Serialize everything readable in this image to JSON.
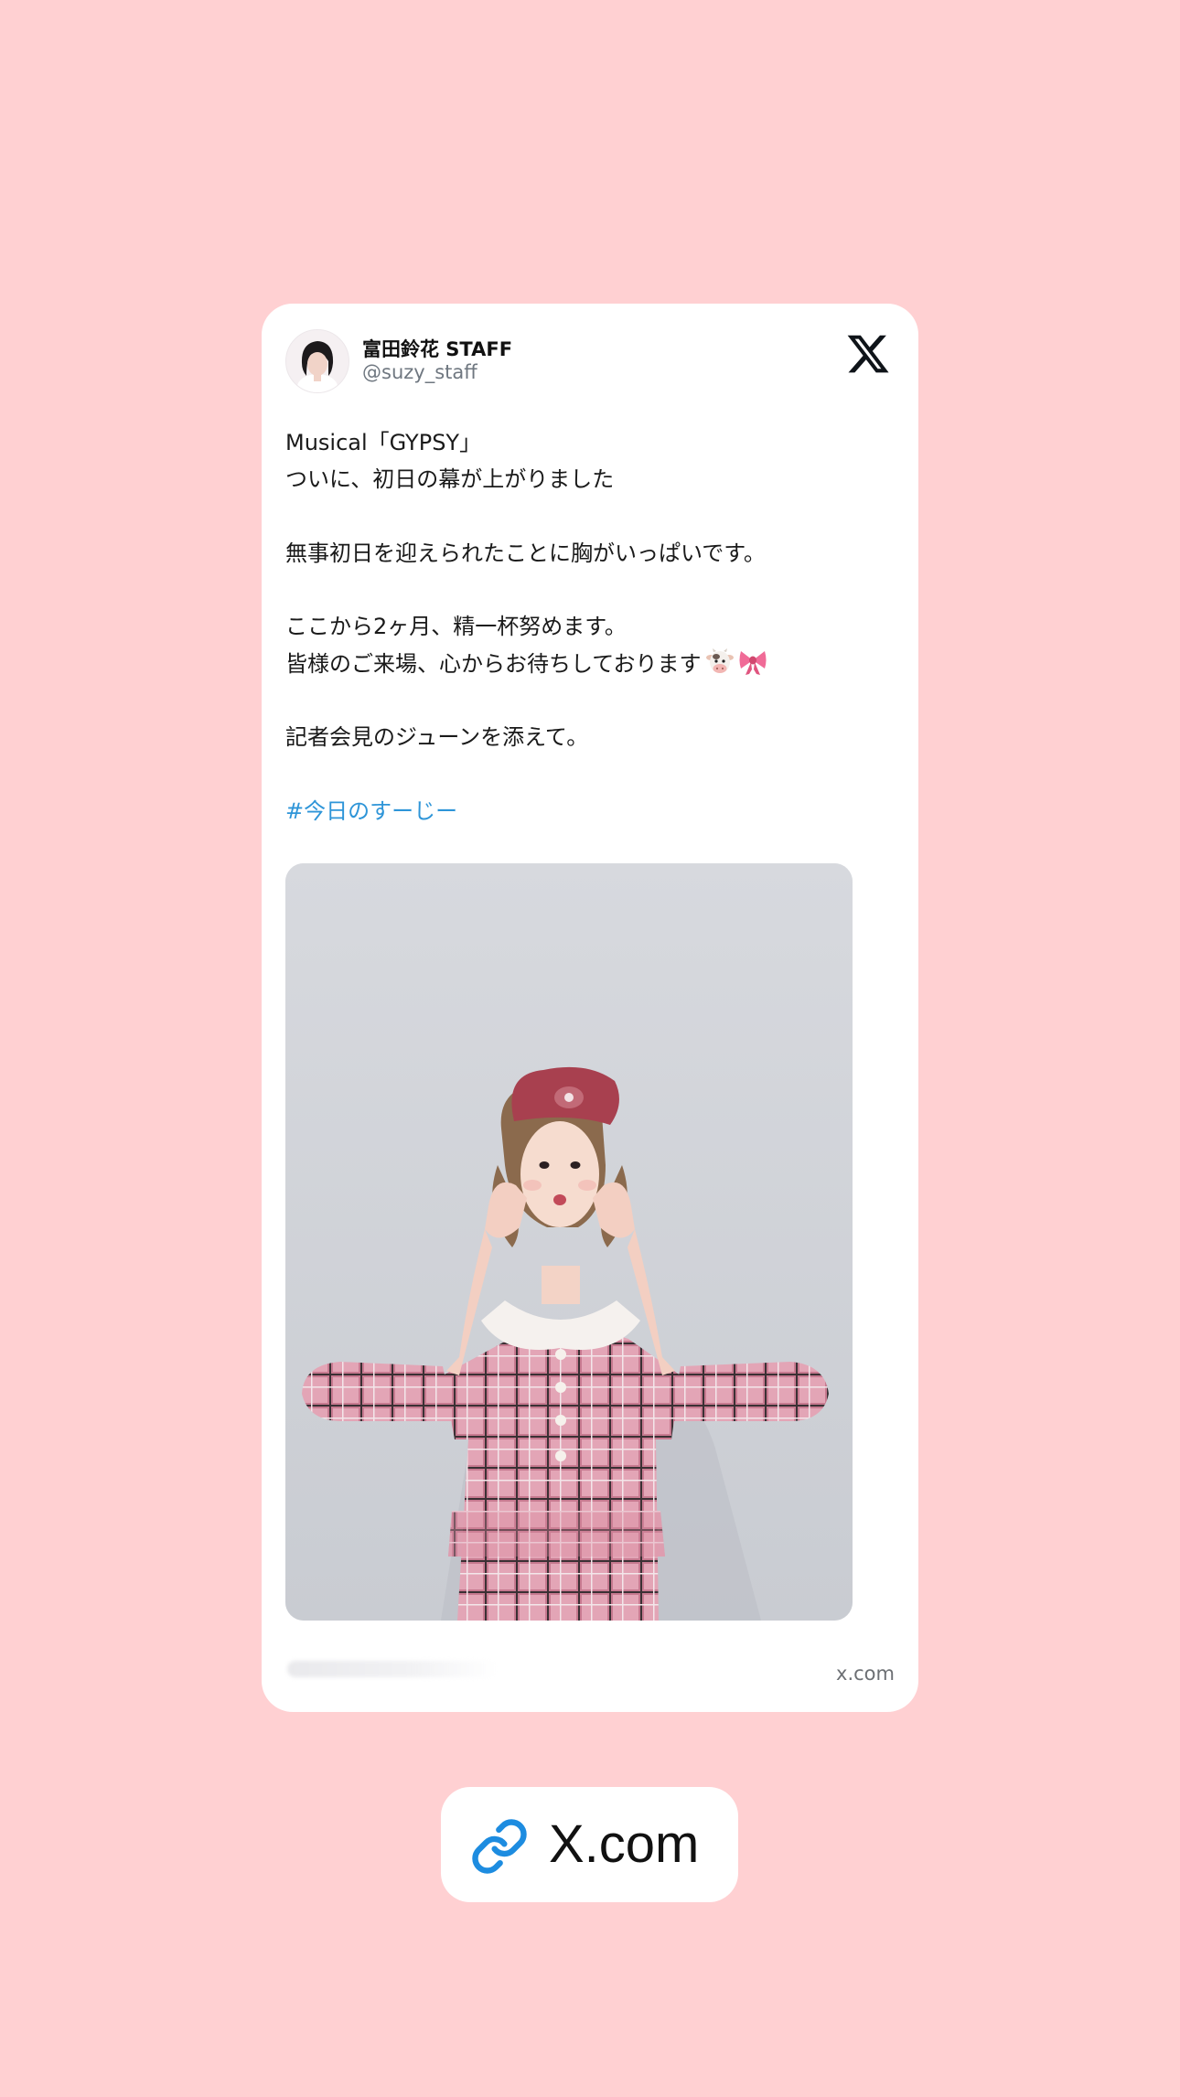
{
  "tweet": {
    "author": {
      "name": "富田鈴花 STAFF",
      "handle": "@suzy_staff"
    },
    "body_lines": [
      "Musical「GYPSY」",
      "ついに、初日の幕が上がりました",
      "",
      "無事初日を迎えられたことに胸がいっぱいです。",
      "",
      "ここから2ヶ月、精一杯努めます。",
      "皆様のご来場、心からお待ちしております",
      "",
      "記者会見のジューンを添えて。",
      ""
    ],
    "emojis": [
      "cow-face-emoji",
      "ribbon-emoji"
    ],
    "hashtag": "#今日のすーじー",
    "source_domain": "x.com"
  },
  "link_button": {
    "label": "X.com",
    "icon": "link-icon"
  },
  "colors": {
    "background": "#ffd0d2",
    "hashtag": "#2e95d8",
    "link_icon": "#1d8ce0"
  }
}
